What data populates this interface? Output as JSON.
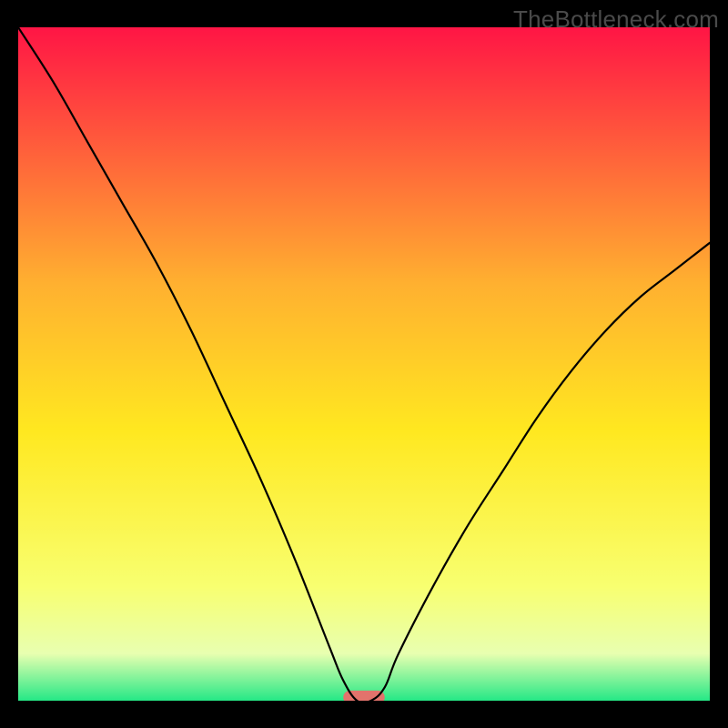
{
  "watermark": "TheBottleneck.com",
  "chart_data": {
    "type": "line",
    "title": "",
    "xlabel": "",
    "ylabel": "",
    "xlim": [
      0,
      100
    ],
    "ylim": [
      0,
      100
    ],
    "x": [
      0,
      5,
      10,
      15,
      20,
      25,
      30,
      35,
      40,
      45,
      47,
      49,
      51,
      53,
      55,
      60,
      65,
      70,
      75,
      80,
      85,
      90,
      95,
      100
    ],
    "values": [
      100,
      92,
      83,
      74,
      65,
      55,
      44,
      33,
      21,
      8,
      3,
      0,
      0,
      2,
      7,
      17,
      26,
      34,
      42,
      49,
      55,
      60,
      64,
      68
    ],
    "annotations": [
      {
        "type": "pill",
        "x_center": 50,
        "y": 0.5,
        "width": 6,
        "height": 2,
        "color": "#e2736c"
      }
    ],
    "background_gradient": {
      "top": "#ff1545",
      "upper_mid": "#ffb030",
      "mid": "#ffe820",
      "lower_mid": "#f8ff70",
      "band": "#e8ffb0",
      "bottom": "#25e886"
    }
  }
}
